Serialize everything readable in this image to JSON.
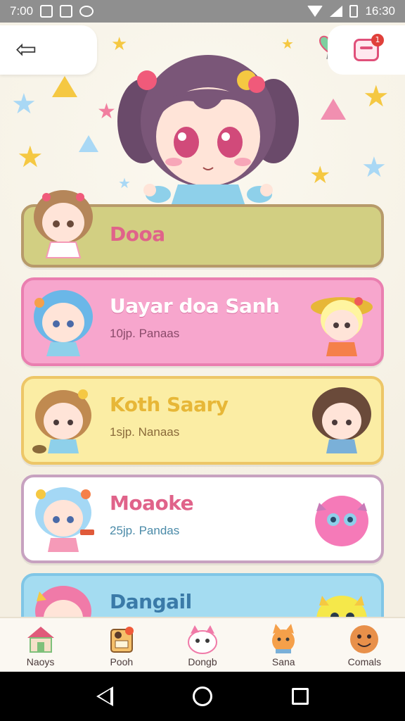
{
  "status_bar": {
    "time": "7:00",
    "clock": "16:30"
  },
  "colors": {
    "card_1": "#d2cf82",
    "card_2": "#f7a6cd",
    "card_3": "#fbeda4",
    "card_4": "#ffffff",
    "card_5": "#a4dcf1"
  },
  "header": {
    "back_icon": "back-arrow-icon",
    "balloon_icon": "heart-balloon-icon",
    "bag_icon": "shopping-bag-icon",
    "bag_badge": "1"
  },
  "cards": [
    {
      "title": "Dooa",
      "subtitle": ""
    },
    {
      "title": "Uayar doa Sanh",
      "subtitle": "10jp. Panaas"
    },
    {
      "title": "Koth Saary",
      "subtitle": "1sjp. Nanaas"
    },
    {
      "title": "Moaoke",
      "subtitle": "25jp. Pandas"
    },
    {
      "title": "Dangail",
      "subtitle": ""
    }
  ],
  "bottom_nav": [
    {
      "label": "Naoys",
      "icon": "house-icon"
    },
    {
      "label": "Pooh",
      "icon": "shop-character-icon"
    },
    {
      "label": "Dongb",
      "icon": "cat-character-icon"
    },
    {
      "label": "Sana",
      "icon": "fox-character-icon"
    },
    {
      "label": "Comals",
      "icon": "smiley-character-icon"
    }
  ]
}
